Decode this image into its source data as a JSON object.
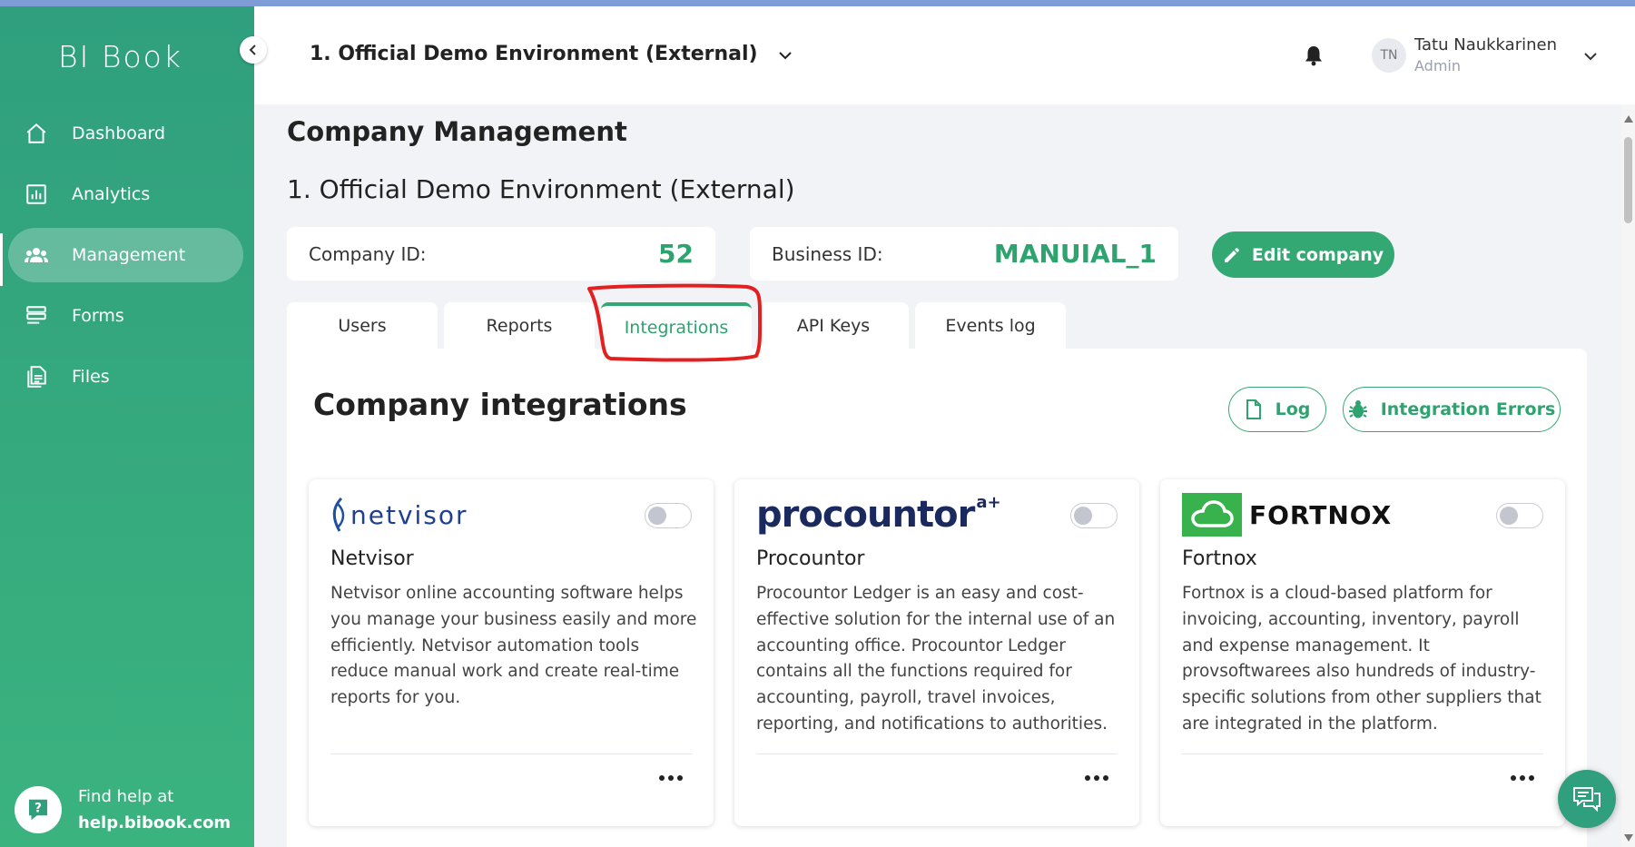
{
  "app": {
    "logo": "BI Book"
  },
  "colors": {
    "accent": "#34a873",
    "sidebar": "#2f9f7d",
    "annotation": "#e32020"
  },
  "sidebar": {
    "items": [
      {
        "label": "Dashboard",
        "icon": "home-icon",
        "active": false
      },
      {
        "label": "Analytics",
        "icon": "bar-chart-icon",
        "active": false
      },
      {
        "label": "Management",
        "icon": "users-icon",
        "active": true
      },
      {
        "label": "Forms",
        "icon": "forms-icon",
        "active": false
      },
      {
        "label": "Files",
        "icon": "files-icon",
        "active": false
      }
    ],
    "help": {
      "line1": "Find help at",
      "line2": "help.bibook.com"
    }
  },
  "header": {
    "environment": "1. Official Demo Environment (External)",
    "user": {
      "initials": "TN",
      "name": "Tatu Naukkarinen",
      "role": "Admin"
    }
  },
  "main": {
    "page_title": "Company Management",
    "company_name": "1. Official Demo Environment (External)",
    "company_id": {
      "label": "Company ID:",
      "value": "52"
    },
    "business_id": {
      "label": "Business ID:",
      "value": "MANUIAL_1"
    },
    "edit_button": "Edit company",
    "tabs": [
      {
        "label": "Users",
        "active": false
      },
      {
        "label": "Reports",
        "active": false
      },
      {
        "label": "Integrations",
        "active": true
      },
      {
        "label": "API Keys",
        "active": false
      },
      {
        "label": "Events log",
        "active": false
      }
    ],
    "panel": {
      "title": "Company integrations",
      "log_button": "Log",
      "errors_button": "Integration Errors",
      "cards": [
        {
          "logo": "netvisor",
          "name": "Netvisor",
          "enabled": false,
          "description": "Netvisor online accounting software helps you manage your business easily and more efficiently. Netvisor automation tools reduce manual work and create real-time reports for you."
        },
        {
          "logo": "procountor",
          "logo_sup": "a+",
          "name": "Procountor",
          "enabled": false,
          "description": "Procountor Ledger is an easy and cost-effective solution for the internal use of an accounting office. Procountor Ledger contains all the functions required for accounting, payroll, travel invoices, reporting, and notifications to authorities."
        },
        {
          "logo": "FORTNOX",
          "name": "Fortnox",
          "enabled": false,
          "description": "Fortnox is a cloud-based platform for invoicing, accounting, inventory, payroll and expense management. It provsoftwarees also hundreds of industry-specific solutions from other suppliers that are integrated in the platform."
        }
      ]
    }
  }
}
